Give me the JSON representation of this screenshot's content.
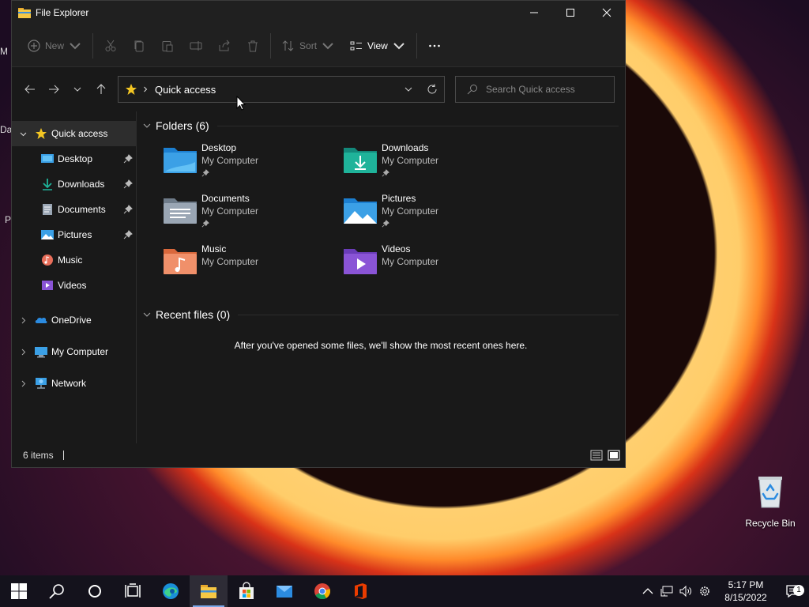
{
  "desktop_peek": [
    "M",
    "Da",
    "P"
  ],
  "recycle_bin": {
    "label": "Recycle Bin"
  },
  "window": {
    "title": "File Explorer",
    "toolbar": {
      "new_label": "New",
      "sort_label": "Sort",
      "view_label": "View"
    },
    "address": {
      "path": "Quick access"
    },
    "search": {
      "placeholder": "Search Quick access"
    },
    "sidebar": {
      "quick_access": "Quick access",
      "pinned": [
        {
          "label": "Desktop",
          "icon": "desktop-icon",
          "pinned": true
        },
        {
          "label": "Downloads",
          "icon": "download-icon",
          "pinned": true
        },
        {
          "label": "Documents",
          "icon": "documents-icon",
          "pinned": true
        },
        {
          "label": "Pictures",
          "icon": "pictures-icon",
          "pinned": true
        },
        {
          "label": "Music",
          "icon": "music-icon",
          "pinned": false
        },
        {
          "label": "Videos",
          "icon": "videos-icon",
          "pinned": false
        }
      ],
      "roots": [
        {
          "label": "OneDrive",
          "icon": "cloud-icon"
        },
        {
          "label": "My Computer",
          "icon": "computer-icon"
        },
        {
          "label": "Network",
          "icon": "network-icon"
        }
      ]
    },
    "content": {
      "folders_header": "Folders (6)",
      "folders": [
        {
          "name": "Desktop",
          "location": "My Computer",
          "pinned": true,
          "icon": "desktop-folder-icon"
        },
        {
          "name": "Downloads",
          "location": "My Computer",
          "pinned": true,
          "icon": "downloads-folder-icon"
        },
        {
          "name": "Documents",
          "location": "My Computer",
          "pinned": true,
          "icon": "documents-folder-icon"
        },
        {
          "name": "Pictures",
          "location": "My Computer",
          "pinned": true,
          "icon": "pictures-folder-icon"
        },
        {
          "name": "Music",
          "location": "My Computer",
          "pinned": false,
          "icon": "music-folder-icon"
        },
        {
          "name": "Videos",
          "location": "My Computer",
          "pinned": false,
          "icon": "videos-folder-icon"
        }
      ],
      "recent_header": "Recent files (0)",
      "recent_empty": "After you've opened some files, we'll show the most recent ones here."
    },
    "status": {
      "items": "6 items"
    }
  },
  "taskbar": {
    "time": "5:17 PM",
    "date": "8/15/2022",
    "notification_count": "1"
  },
  "colors": {
    "accent": "#4aa3ff",
    "folder_blue": "#3ba0e6",
    "folder_teal": "#1fb39a",
    "window_bg": "#191919"
  }
}
